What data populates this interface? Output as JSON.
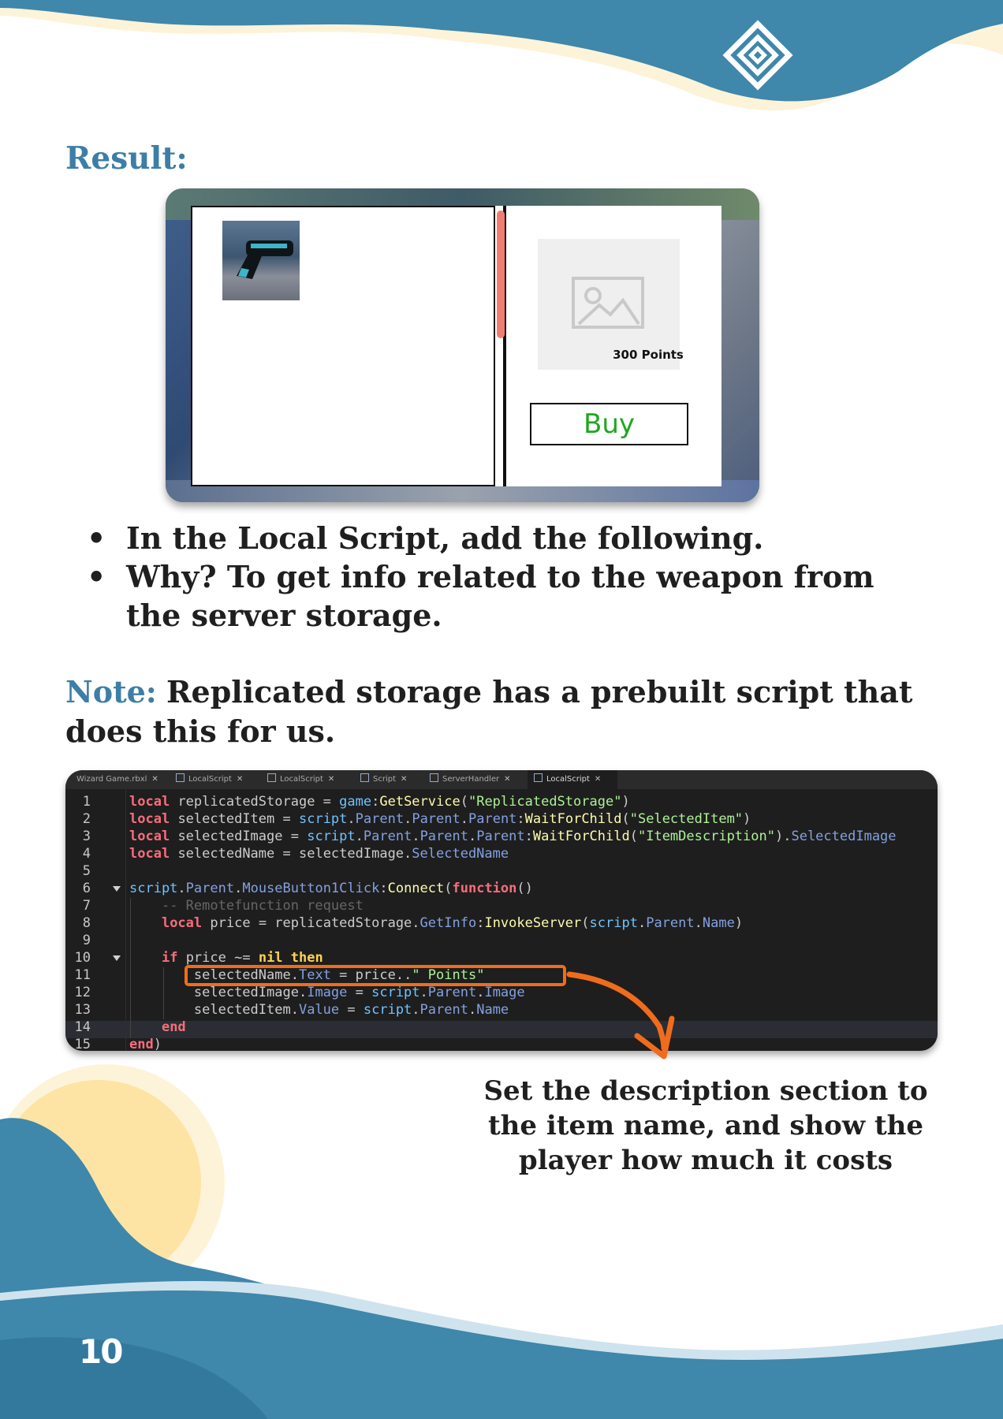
{
  "result_heading": "Result:",
  "shop_preview": {
    "price_text": "300 Points",
    "buy_label": "Buy",
    "scrollbar_color": "#f27b72",
    "buy_text_color": "#1ea81e"
  },
  "bullets": [
    "In the Local Script, add the following.",
    "Why? To get info related to the weapon from the server storage."
  ],
  "note": {
    "label": "Note:",
    "text": "Replicated storage has a prebuilt script that does this for us."
  },
  "editor": {
    "tabs": [
      {
        "label": "Wizard Game.rbxl",
        "active": false,
        "icon": "none"
      },
      {
        "label": "LocalScript",
        "active": false,
        "icon": "local-script-icon"
      },
      {
        "label": "LocalScript",
        "active": false,
        "icon": "local-script-icon"
      },
      {
        "label": "Script",
        "active": false,
        "icon": "script-icon"
      },
      {
        "label": "ServerHandler",
        "active": false,
        "icon": "script-icon"
      },
      {
        "label": "LocalScript",
        "active": true,
        "icon": "local-script-icon"
      }
    ],
    "line_numbers": [
      "1",
      "2",
      "3",
      "4",
      "5",
      "6",
      "7",
      "8",
      "9",
      "10",
      "11",
      "12",
      "13",
      "14",
      "15"
    ],
    "lines": [
      "local replicatedStorage = game:GetService(\"ReplicatedStorage\")",
      "local selectedItem = script.Parent.Parent.Parent:WaitForChild(\"SelectedItem\")",
      "local selectedImage = script.Parent.Parent.Parent:WaitForChild(\"ItemDescription\").SelectedImage",
      "local selectedName = selectedImage.SelectedName",
      "",
      "script.Parent.MouseButton1Click:Connect(function()",
      "    -- Remotefunction request",
      "    local price = replicatedStorage.GetInfo:InvokeServer(script.Parent.Name)",
      "",
      "    if price ~= nil then",
      "        selectedName.Text = price..\" Points\"",
      "        selectedImage.Image = script.Parent.Image",
      "        selectedItem.Value = script.Parent.Name",
      "    end",
      "end)"
    ],
    "highlight_color": "#f06c1d"
  },
  "annotation": "Set the description section to the item name, and show the player how much it costs",
  "page_number": "10",
  "colors": {
    "brand_blue": "#3d7ea6",
    "wave_blue": "#3f87ab",
    "cream": "#fdf3d8",
    "sun_yellow": "#fde4a4"
  }
}
